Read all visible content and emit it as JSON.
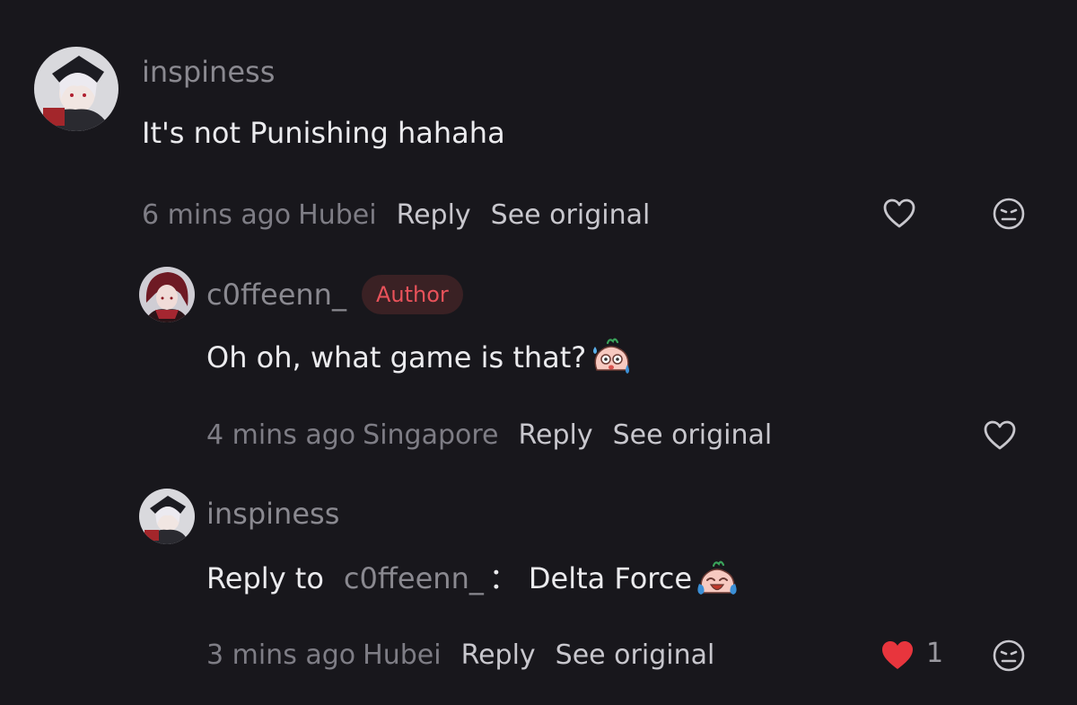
{
  "comments": [
    {
      "username": "inspiness",
      "text": "It's not Punishing hahaha",
      "time": "6 mins ago",
      "location": "Hubei",
      "reply_label": "Reply",
      "see_original_label": "See original",
      "liked": false
    },
    {
      "username": "c0ffeenn_",
      "badge": "Author",
      "text": "Oh oh, what game is that?",
      "emoji": "sweating-face-emoji",
      "time": "4 mins ago",
      "location": "Singapore",
      "reply_label": "Reply",
      "see_original_label": "See original",
      "liked": false
    },
    {
      "username": "inspiness",
      "reply_prefix": "Reply to",
      "reply_target": "c0ffeenn_",
      "separator": "：",
      "text": "Delta Force",
      "emoji": "crying-laughing-face-emoji",
      "time": "3 mins ago",
      "location": "Hubei",
      "reply_label": "Reply",
      "see_original_label": "See original",
      "liked": true,
      "like_count": "1"
    }
  ],
  "colors": {
    "background": "#18171c",
    "author_badge_bg": "#3a2124",
    "author_badge_text": "#e8525a",
    "like_red": "#e8353d",
    "muted_text": "#8a8990",
    "primary_text": "#ebebee"
  },
  "icons": {
    "like": "heart-outline-icon",
    "liked": "heart-filled-icon",
    "dislike": "neutral-face-icon"
  }
}
